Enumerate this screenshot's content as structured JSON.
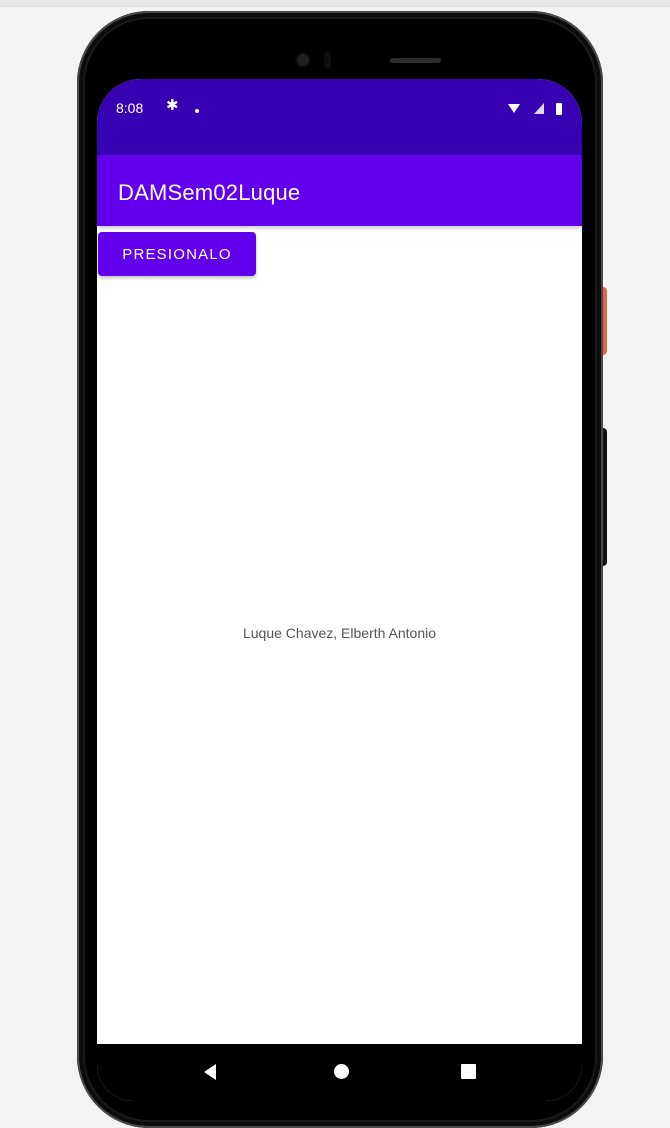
{
  "status_bar": {
    "time": "8:08",
    "icons": [
      "gear-icon",
      "notification-dot-icon",
      "wifi-icon",
      "signal-icon",
      "battery-icon"
    ]
  },
  "app_bar": {
    "title": "DAMSem02Luque"
  },
  "main": {
    "button_label": "PRESIONALO",
    "center_text": "Luque Chavez, Elberth Antonio"
  },
  "navigation": {
    "icons": [
      "back-icon",
      "home-icon",
      "recents-icon"
    ]
  },
  "colors": {
    "status_bar": "#3700b3",
    "primary": "#6200ee",
    "background": "#ffffff",
    "text_secondary": "#555555"
  }
}
